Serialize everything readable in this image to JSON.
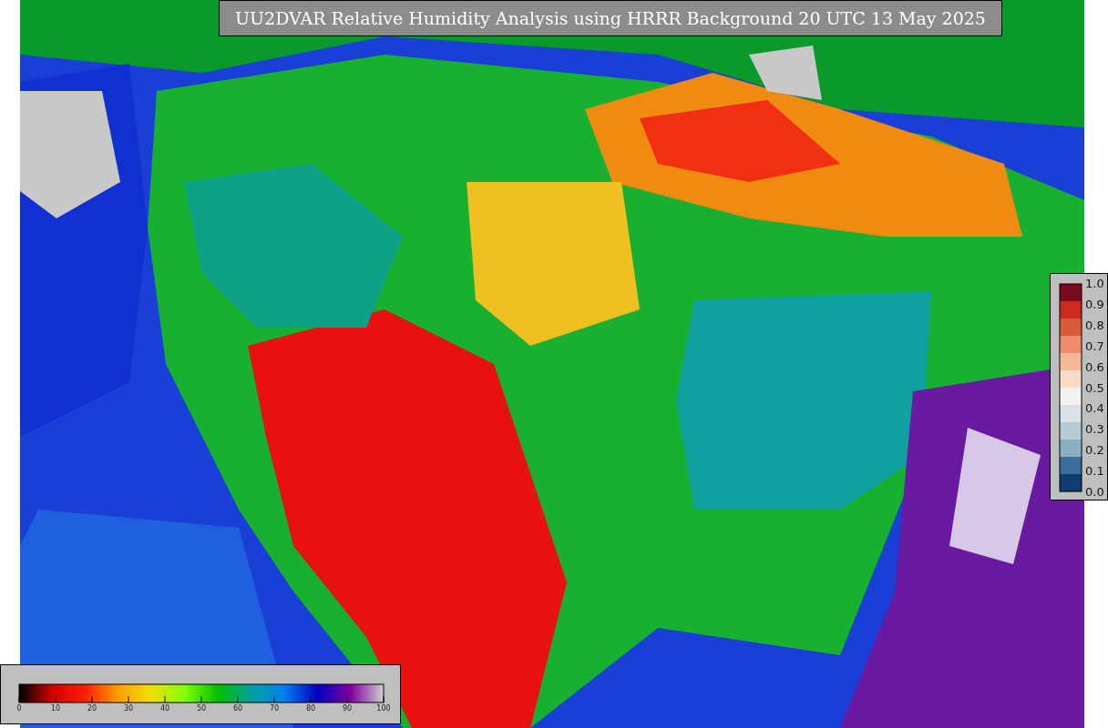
{
  "title": "UU2DVAR Relative Humidity Analysis using HRRR Background 20 UTC 13 May 2025",
  "humidity_colorbar": {
    "ticks": [
      "0",
      "10",
      "20",
      "30",
      "40",
      "50",
      "60",
      "70",
      "80",
      "90",
      "100"
    ]
  },
  "observation_colorbar": {
    "ticks": [
      "1.0",
      "0.9",
      "0.8",
      "0.7",
      "0.6",
      "0.5",
      "0.4",
      "0.3",
      "0.2",
      "0.1",
      "0.0"
    ]
  }
}
